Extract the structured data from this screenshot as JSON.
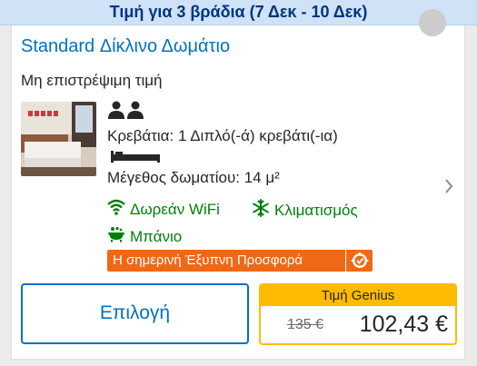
{
  "header": {
    "stay_summary": "Τιμή για 3 βράδια (7 Δεκ - 10 Δεκ)"
  },
  "room": {
    "title": "Standard Δίκλινο Δωμάτιο",
    "rate_type": "Μη επιστρέψιμη τιμή",
    "occupancy_icon": "two-persons-icon",
    "beds": "Κρεβάτια: 1 Διπλό(-ά) κρεβάτι(-ια)",
    "bed_icon": "double-bed-icon",
    "size": "Μέγεθος δωματίου: 14 μ²"
  },
  "facilities": [
    {
      "icon": "wifi-icon",
      "label": "Δωρεάν WiFi"
    },
    {
      "icon": "snowflake-icon",
      "label": "Κλιματισμός"
    },
    {
      "icon": "bathtub-icon",
      "label": "Μπάνιο"
    }
  ],
  "badge": {
    "label": "Η σημερινή Έξυπνη Προσφορά",
    "icon": "smart-deal-icon"
  },
  "actions": {
    "select_label": "Επιλογή"
  },
  "pricing": {
    "header": "Τιμή Genius",
    "old_price": "135 €",
    "new_price": "102,43 €"
  },
  "colors": {
    "link_blue": "#0071c2",
    "green": "#008009",
    "genius_yellow": "#febb02",
    "deal_orange": "#ef6817",
    "banner_bg": "#cfe2f6"
  }
}
